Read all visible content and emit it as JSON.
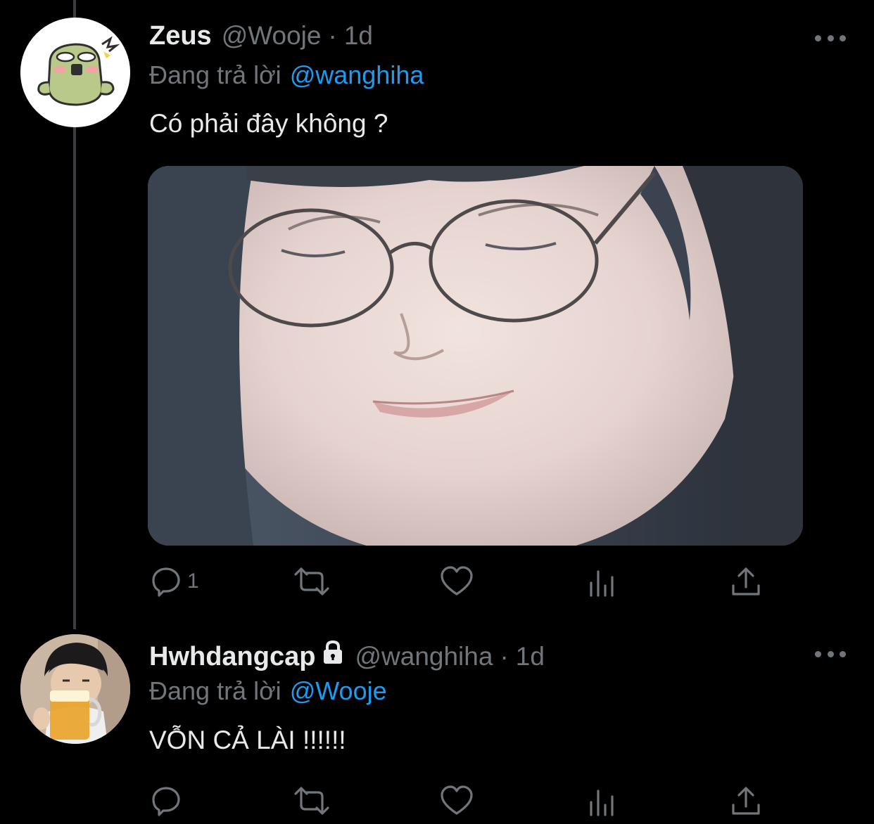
{
  "tweets": [
    {
      "display_name": "Zeus",
      "handle": "@Wooje",
      "separator": "·",
      "time": "1d",
      "reply_prefix": "Đang trả lời",
      "reply_to": "@wanghiha",
      "text": "Có phải đây không ?",
      "reply_count": "1",
      "has_media": true
    },
    {
      "display_name": "Hwhdangcap",
      "handle": "@wanghiha",
      "separator": "·",
      "time": "1d",
      "reply_prefix": "Đang trả lời",
      "reply_to": "@Wooje",
      "text": "VỖN CẢ LÀI !!!!!!",
      "reply_count": "",
      "protected": true
    }
  ],
  "colors": {
    "background": "#000000",
    "text_primary": "#e7e9ea",
    "text_secondary": "#71767b",
    "link": "#1d9bf0",
    "thread_line": "#3a3f44"
  },
  "icons": [
    "reply-icon",
    "retweet-icon",
    "like-icon",
    "analytics-icon",
    "share-icon",
    "more-icon",
    "lock-icon"
  ]
}
